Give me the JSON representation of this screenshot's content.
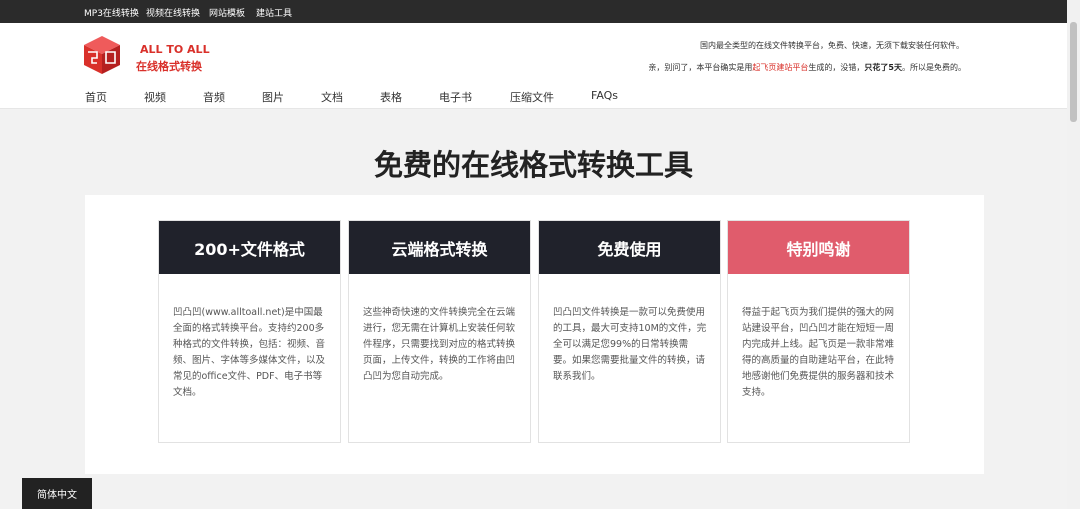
{
  "topbar": {
    "links": [
      "MP3在线转换",
      "视频在线转换",
      "网站模板",
      "建站工具"
    ]
  },
  "logo": {
    "en": "ALL TO ALL",
    "cn": "在线格式转换",
    "brand_color": "#d9302a"
  },
  "header": {
    "tagline1": "国内最全类型的在线文件转换平台，免费、快速，无须下载安装任何软件。",
    "tagline2": {
      "pre": "亲，别问了，本平台确实是用",
      "link": "起飞页建站平台",
      "mid": "生成的，没错，",
      "bold": "只花了5天",
      "post": "。所以是免费的。"
    }
  },
  "nav": [
    "首页",
    "视频",
    "音频",
    "图片",
    "文档",
    "表格",
    "电子书",
    "压缩文件",
    "FAQs"
  ],
  "hero": {
    "title": "免费的在线格式转换工具"
  },
  "cards": [
    {
      "title": "200+文件格式",
      "body": "凹凸凹(www.alltoall.net)是中国最全面的格式转换平台。支持约200多种格式的文件转换，包括：视频、音频、图片、字体等多媒体文件，以及常见的office文件、PDF、电子书等文档。"
    },
    {
      "title": "云端格式转换",
      "body": "这些神奇快速的文件转换完全在云端进行，您无需在计算机上安装任何软件程序，只需要找到对应的格式转换页面，上传文件，转换的工作将由凹凸凹为您自动完成。"
    },
    {
      "title": "免费使用",
      "body": "凹凸凹文件转换是一款可以免费使用的工具，最大可支持10M的文件，完全可以满足您99%的日常转换需要。如果您需要批量文件的转换，请联系我们。"
    },
    {
      "title": "特别鸣谢",
      "body": "得益于起飞页为我们提供的强大的网站建设平台，凹凸凹才能在短短一周内完成并上线。起飞页是一款非常难得的高质量的自助建站平台，在此特地感谢他们免费提供的服务器和技术支持。",
      "accent": "#e05c6c"
    }
  ],
  "language_button": "简体中文"
}
